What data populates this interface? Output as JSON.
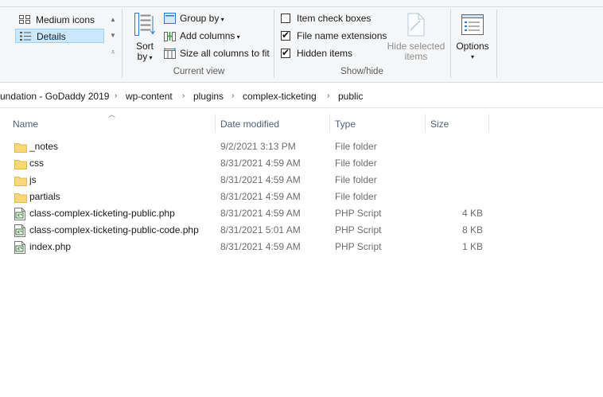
{
  "ribbon": {
    "layout": {
      "medium_icons": "Medium icons",
      "details": "Details"
    },
    "sort_by_line1": "Sort",
    "sort_by_line2": "by",
    "group_by": "Group by",
    "add_columns": "Add columns",
    "size_all_columns": "Size all columns to fit",
    "current_view_label": "Current view",
    "item_check_boxes": {
      "label": "Item check boxes",
      "checked": false
    },
    "file_name_extensions": {
      "label": "File name extensions",
      "checked": true
    },
    "hidden_items": {
      "label": "Hidden items",
      "checked": true
    },
    "hide_selected_line1": "Hide selected",
    "hide_selected_line2": "items",
    "show_hide_label": "Show/hide",
    "options": "Options"
  },
  "address": {
    "crumbs": [
      "undation - GoDaddy 2019",
      "wp-content",
      "plugins",
      "complex-ticketing",
      "public"
    ]
  },
  "columns": {
    "name": "Name",
    "date_modified": "Date modified",
    "type": "Type",
    "size": "Size"
  },
  "files": [
    {
      "name": "_notes",
      "date": "9/2/2021 3:13 PM",
      "type": "File folder",
      "size": "",
      "icon": "folder-icon"
    },
    {
      "name": "css",
      "date": "8/31/2021 4:59 AM",
      "type": "File folder",
      "size": "",
      "icon": "folder-icon"
    },
    {
      "name": "js",
      "date": "8/31/2021 4:59 AM",
      "type": "File folder",
      "size": "",
      "icon": "folder-icon"
    },
    {
      "name": "partials",
      "date": "8/31/2021 4:59 AM",
      "type": "File folder",
      "size": "",
      "icon": "folder-icon"
    },
    {
      "name": "class-complex-ticketing-public.php",
      "date": "8/31/2021 4:59 AM",
      "type": "PHP Script",
      "size": "4 KB",
      "icon": "php-file-icon"
    },
    {
      "name": "class-complex-ticketing-public-code.php",
      "date": "8/31/2021 5:01 AM",
      "type": "PHP Script",
      "size": "8 KB",
      "icon": "php-file-icon"
    },
    {
      "name": "index.php",
      "date": "8/31/2021 4:59 AM",
      "type": "PHP Script",
      "size": "1 KB",
      "icon": "php-file-icon"
    }
  ],
  "colors": {
    "selection_bg": "#cce8ff",
    "folder": "#f8d775",
    "header_text": "#4c607a"
  }
}
